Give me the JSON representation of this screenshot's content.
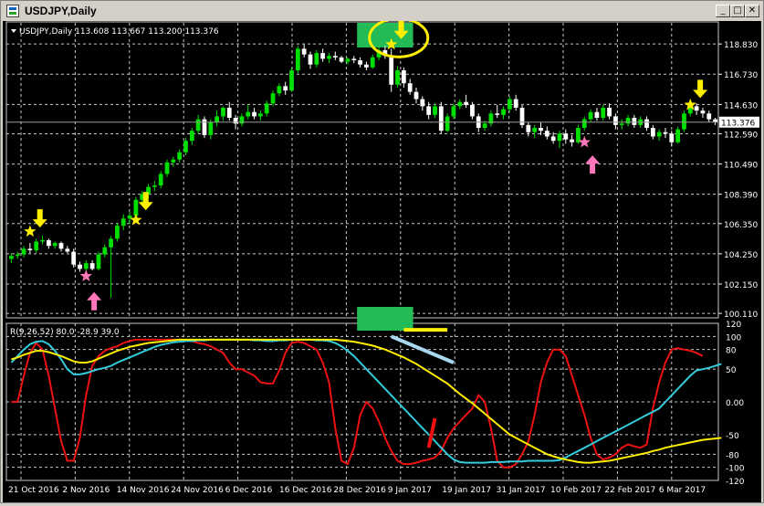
{
  "window": {
    "title": "USDJPY,Daily",
    "buttons": {
      "minimize": "_",
      "maximize": "□",
      "close": "✕"
    }
  },
  "colors": {
    "background": "#000000",
    "grid": "#c8c8c8",
    "bull_candle": "#00e000",
    "bear_candle": "#ffffff",
    "cyan_line": "#33ccdd",
    "yellow_line": "#ffee00",
    "red_line": "#ee1111",
    "arrow_down": "#ffee00",
    "arrow_up": "#ff77bb",
    "green_box": "#22bb55"
  },
  "chart_data": [
    {
      "type": "candlestick",
      "title": "USDJPY,Daily",
      "header": "USDJPY,Daily  113.608 113.667 113.200 113.376",
      "current_price_label": "113.376",
      "ylim": [
        99.8,
        120.3
      ],
      "yticks": [
        "118.830",
        "116.730",
        "114.630",
        "112.590",
        "110.490",
        "108.390",
        "106.350",
        "104.250",
        "102.150",
        "100.110"
      ],
      "xticks": [
        "21 Oct 2016",
        "2 Nov 2016",
        "14 Nov 2016",
        "24 Nov 2016",
        "6 Dec 2016",
        "16 Dec 2016",
        "28 Dec 2016",
        "9 Jan 2017",
        "19 Jan 2017",
        "31 Jan 2017",
        "10 Feb 2017",
        "22 Feb 2017",
        "6 Mar 2017"
      ],
      "candles": [
        [
          103.9,
          104.3,
          103.6,
          104.1
        ],
        [
          104.1,
          104.4,
          103.9,
          104.2
        ],
        [
          104.2,
          104.8,
          104.0,
          104.6
        ],
        [
          104.6,
          105.0,
          104.3,
          104.5
        ],
        [
          104.5,
          105.3,
          104.3,
          105.1
        ],
        [
          105.1,
          105.5,
          104.9,
          105.2
        ],
        [
          105.2,
          105.3,
          104.6,
          104.8
        ],
        [
          104.8,
          105.1,
          104.6,
          105.0
        ],
        [
          105.0,
          105.1,
          104.4,
          104.6
        ],
        [
          104.6,
          104.8,
          104.3,
          104.4
        ],
        [
          104.4,
          104.6,
          103.3,
          103.5
        ],
        [
          103.5,
          103.7,
          103.0,
          103.2
        ],
        [
          103.2,
          103.8,
          103.0,
          103.6
        ],
        [
          103.6,
          103.8,
          103.1,
          103.2
        ],
        [
          103.2,
          104.4,
          103.1,
          104.2
        ],
        [
          104.2,
          104.9,
          104.0,
          104.7
        ],
        [
          104.7,
          105.5,
          101.2,
          105.3
        ],
        [
          105.3,
          106.4,
          105.1,
          106.2
        ],
        [
          106.2,
          107.0,
          105.9,
          106.7
        ],
        [
          106.7,
          107.2,
          106.3,
          106.9
        ],
        [
          106.9,
          108.2,
          106.7,
          108.0
        ],
        [
          108.0,
          108.6,
          107.6,
          108.4
        ],
        [
          108.4,
          109.1,
          108.1,
          108.9
        ],
        [
          108.9,
          109.3,
          108.6,
          109.0
        ],
        [
          109.0,
          110.0,
          108.8,
          109.8
        ],
        [
          109.8,
          110.8,
          109.6,
          110.6
        ],
        [
          110.6,
          111.0,
          110.3,
          110.8
        ],
        [
          110.8,
          111.5,
          110.6,
          111.3
        ],
        [
          111.3,
          112.3,
          111.1,
          112.1
        ],
        [
          112.1,
          113.0,
          111.8,
          112.8
        ],
        [
          112.8,
          113.9,
          112.6,
          113.6
        ],
        [
          113.6,
          113.8,
          112.3,
          112.5
        ],
        [
          112.5,
          113.6,
          112.2,
          113.4
        ],
        [
          113.4,
          114.2,
          113.1,
          113.8
        ],
        [
          113.8,
          114.5,
          113.5,
          114.4
        ],
        [
          114.4,
          114.8,
          113.5,
          113.7
        ],
        [
          113.7,
          113.9,
          112.9,
          113.3
        ],
        [
          113.3,
          114.0,
          113.1,
          113.8
        ],
        [
          113.8,
          114.6,
          113.6,
          114.1
        ],
        [
          114.1,
          114.4,
          113.6,
          113.8
        ],
        [
          113.8,
          114.2,
          113.5,
          114.0
        ],
        [
          114.0,
          114.9,
          113.8,
          114.7
        ],
        [
          114.7,
          115.6,
          114.5,
          115.4
        ],
        [
          115.4,
          116.1,
          115.2,
          115.9
        ],
        [
          115.9,
          116.2,
          115.3,
          115.6
        ],
        [
          115.6,
          117.2,
          115.5,
          117.0
        ],
        [
          117.0,
          118.7,
          116.8,
          118.5
        ],
        [
          118.5,
          118.8,
          117.9,
          118.1
        ],
        [
          118.1,
          118.3,
          117.1,
          117.4
        ],
        [
          117.4,
          118.4,
          117.2,
          118.2
        ],
        [
          118.2,
          118.5,
          117.6,
          117.8
        ],
        [
          117.8,
          118.2,
          117.5,
          118.0
        ],
        [
          118.0,
          118.3,
          117.7,
          117.9
        ],
        [
          117.9,
          118.0,
          117.5,
          117.6
        ],
        [
          117.6,
          117.9,
          117.4,
          117.8
        ],
        [
          117.8,
          118.0,
          117.5,
          117.7
        ],
        [
          117.7,
          117.9,
          117.2,
          117.4
        ],
        [
          117.4,
          117.6,
          117.0,
          117.2
        ],
        [
          117.2,
          118.1,
          117.1,
          117.9
        ],
        [
          117.9,
          118.6,
          117.7,
          118.4
        ],
        [
          118.4,
          118.7,
          117.8,
          118.0
        ],
        [
          118.0,
          118.5,
          115.5,
          116.0
        ],
        [
          116.0,
          117.3,
          115.8,
          117.0
        ],
        [
          117.0,
          117.2,
          115.8,
          116.1
        ],
        [
          116.1,
          116.4,
          115.3,
          115.5
        ],
        [
          115.5,
          115.8,
          114.7,
          115.0
        ],
        [
          115.0,
          115.2,
          114.2,
          114.5
        ],
        [
          114.5,
          114.8,
          113.6,
          113.9
        ],
        [
          113.9,
          114.7,
          113.7,
          114.5
        ],
        [
          114.5,
          114.8,
          112.6,
          112.8
        ],
        [
          112.8,
          114.0,
          112.7,
          113.8
        ],
        [
          113.8,
          114.7,
          113.6,
          114.5
        ],
        [
          114.5,
          115.0,
          114.3,
          114.8
        ],
        [
          114.8,
          115.3,
          114.4,
          114.6
        ],
        [
          114.6,
          114.8,
          113.6,
          113.8
        ],
        [
          113.8,
          114.0,
          112.7,
          113.0
        ],
        [
          113.0,
          113.5,
          112.8,
          113.3
        ],
        [
          113.3,
          114.2,
          113.1,
          114.0
        ],
        [
          114.0,
          114.6,
          113.7,
          113.9
        ],
        [
          113.9,
          114.5,
          113.6,
          114.3
        ],
        [
          114.3,
          115.2,
          114.1,
          115.0
        ],
        [
          115.0,
          115.3,
          114.2,
          114.4
        ],
        [
          114.4,
          114.6,
          113.0,
          113.2
        ],
        [
          113.2,
          113.4,
          112.4,
          112.7
        ],
        [
          112.7,
          113.2,
          112.3,
          113.0
        ],
        [
          113.0,
          113.4,
          112.5,
          112.8
        ],
        [
          112.8,
          113.1,
          112.2,
          112.4
        ],
        [
          112.4,
          112.7,
          111.9,
          112.1
        ],
        [
          112.1,
          112.8,
          111.6,
          112.6
        ],
        [
          112.6,
          112.9,
          111.9,
          112.2
        ],
        [
          112.2,
          112.5,
          111.7,
          112.0
        ],
        [
          112.0,
          113.2,
          111.9,
          113.0
        ],
        [
          113.0,
          113.8,
          112.8,
          113.6
        ],
        [
          113.6,
          114.3,
          113.4,
          114.1
        ],
        [
          114.1,
          114.4,
          113.5,
          113.7
        ],
        [
          113.7,
          114.6,
          113.5,
          114.4
        ],
        [
          114.4,
          114.7,
          113.6,
          113.8
        ],
        [
          113.8,
          114.0,
          112.9,
          113.2
        ],
        [
          113.2,
          113.6,
          112.9,
          113.3
        ],
        [
          113.3,
          113.9,
          113.1,
          113.7
        ],
        [
          113.7,
          113.9,
          113.0,
          113.2
        ],
        [
          113.2,
          113.8,
          113.0,
          113.6
        ],
        [
          113.6,
          113.8,
          112.8,
          113.0
        ],
        [
          113.0,
          113.2,
          112.2,
          112.4
        ],
        [
          112.4,
          112.9,
          112.1,
          112.7
        ],
        [
          112.7,
          113.0,
          112.3,
          112.6
        ],
        [
          112.6,
          112.8,
          111.7,
          112.0
        ],
        [
          112.0,
          113.1,
          111.9,
          112.9
        ],
        [
          112.9,
          114.2,
          112.7,
          114.0
        ],
        [
          114.0,
          114.8,
          113.8,
          114.5
        ],
        [
          114.5,
          114.7,
          113.9,
          114.2
        ],
        [
          114.2,
          114.4,
          113.7,
          114.0
        ],
        [
          114.0,
          114.2,
          113.4,
          113.6
        ],
        [
          113.6,
          113.7,
          113.2,
          113.4
        ]
      ],
      "annotations": {
        "stars_yellow": [
          [
            3,
            105.8
          ],
          [
            20,
            106.6
          ],
          [
            61,
            118.8
          ],
          [
            109,
            114.6
          ]
        ],
        "stars_pink": [
          [
            12,
            102.7
          ],
          [
            92,
            112.0
          ]
        ],
        "arrows_down": [
          [
            4,
            106.2
          ],
          [
            21,
            107.4
          ],
          [
            62,
            119.3
          ],
          [
            110,
            115.2
          ]
        ],
        "arrows_up": [
          [
            13,
            102.1
          ],
          [
            93,
            111.6
          ]
        ],
        "green_box_top": [
          56,
          64
        ],
        "ellipse_center": [
          61,
          119.2
        ]
      }
    },
    {
      "type": "line",
      "header": "R(9,26,52) 80.0 -28.9 39.0",
      "ylim": [
        -120,
        120
      ],
      "yticks": [
        "120",
        "100",
        "80",
        "50",
        "0.00",
        "-50",
        "-80",
        "-100",
        "-120"
      ],
      "series": [
        {
          "color_key": "red_line",
          "values": [
            0,
            0,
            40,
            75,
            90,
            80,
            40,
            -10,
            -60,
            -90,
            -90,
            -55,
            10,
            55,
            70,
            78,
            82,
            85,
            90,
            93,
            95,
            95,
            95,
            95,
            95,
            95,
            95,
            95,
            95,
            93,
            90,
            88,
            85,
            80,
            75,
            60,
            50,
            50,
            45,
            40,
            30,
            28,
            28,
            48,
            75,
            90,
            92,
            90,
            85,
            80,
            60,
            30,
            -40,
            -90,
            -95,
            -70,
            -20,
            0,
            -10,
            -30,
            -55,
            -75,
            -90,
            -95,
            -95,
            -93,
            -90,
            -88,
            -85,
            -75,
            -55,
            -40,
            -30,
            -20,
            -10,
            10,
            0,
            -40,
            -90,
            -100,
            -100,
            -95,
            -80,
            -60,
            -20,
            30,
            60,
            80,
            80,
            70,
            40,
            10,
            -20,
            -55,
            -80,
            -88,
            -85,
            -80,
            -70,
            -65,
            -68,
            -70,
            -65,
            -10,
            30,
            60,
            80,
            82,
            80,
            78,
            75,
            70
          ]
        },
        {
          "color_key": "cyan_line",
          "values": [
            60,
            70,
            80,
            88,
            92,
            93,
            88,
            78,
            65,
            50,
            42,
            42,
            44,
            47,
            50,
            52,
            55,
            60,
            64,
            68,
            72,
            76,
            80,
            84,
            87,
            89,
            91,
            92,
            93,
            93,
            94,
            94,
            95,
            95,
            95,
            95,
            95,
            95,
            95,
            94,
            94,
            93,
            93,
            94,
            94,
            95,
            95,
            95,
            95,
            94,
            94,
            93,
            90,
            85,
            78,
            70,
            60,
            50,
            40,
            30,
            20,
            10,
            0,
            -10,
            -20,
            -30,
            -40,
            -50,
            -60,
            -70,
            -80,
            -88,
            -92,
            -93,
            -93,
            -93,
            -93,
            -92,
            -92,
            -92,
            -91,
            -91,
            -91,
            -90,
            -90,
            -90,
            -90,
            -90,
            -89,
            -85,
            -80,
            -75,
            -70,
            -65,
            -60,
            -55,
            -50,
            -45,
            -40,
            -35,
            -30,
            -25,
            -20,
            -15,
            -10,
            0,
            10,
            20,
            30,
            40,
            48,
            50,
            52,
            55,
            58
          ]
        },
        {
          "color_key": "yellow_line",
          "values": [
            65,
            68,
            72,
            75,
            78,
            78,
            76,
            73,
            70,
            66,
            62,
            60,
            60,
            62,
            66,
            70,
            74,
            78,
            81,
            84,
            86,
            88,
            90,
            91,
            92,
            93,
            94,
            95,
            95,
            95,
            95,
            95,
            95,
            95,
            95,
            95,
            95,
            95,
            95,
            95,
            95,
            95,
            95,
            95,
            95,
            95,
            95,
            95,
            95,
            95,
            95,
            95,
            95,
            94,
            93,
            92,
            90,
            88,
            86,
            83,
            80,
            76,
            72,
            68,
            63,
            58,
            52,
            46,
            40,
            34,
            28,
            20,
            12,
            5,
            -2,
            -10,
            -18,
            -26,
            -34,
            -42,
            -50,
            -55,
            -60,
            -65,
            -70,
            -75,
            -80,
            -83,
            -86,
            -88,
            -90,
            -92,
            -93,
            -93,
            -92,
            -91,
            -90,
            -88,
            -86,
            -84,
            -82,
            -80,
            -78,
            -75,
            -73,
            -70,
            -68,
            -66,
            -64,
            -62,
            -60,
            -58,
            -57,
            -56,
            -55
          ]
        }
      ],
      "annotations": {
        "yellow_bar": [
          63,
          70,
          110
        ],
        "blue_line": [
          61,
          100,
          71,
          60
        ],
        "red_stroke": [
          67,
          -70,
          68,
          -25
        ]
      }
    }
  ]
}
